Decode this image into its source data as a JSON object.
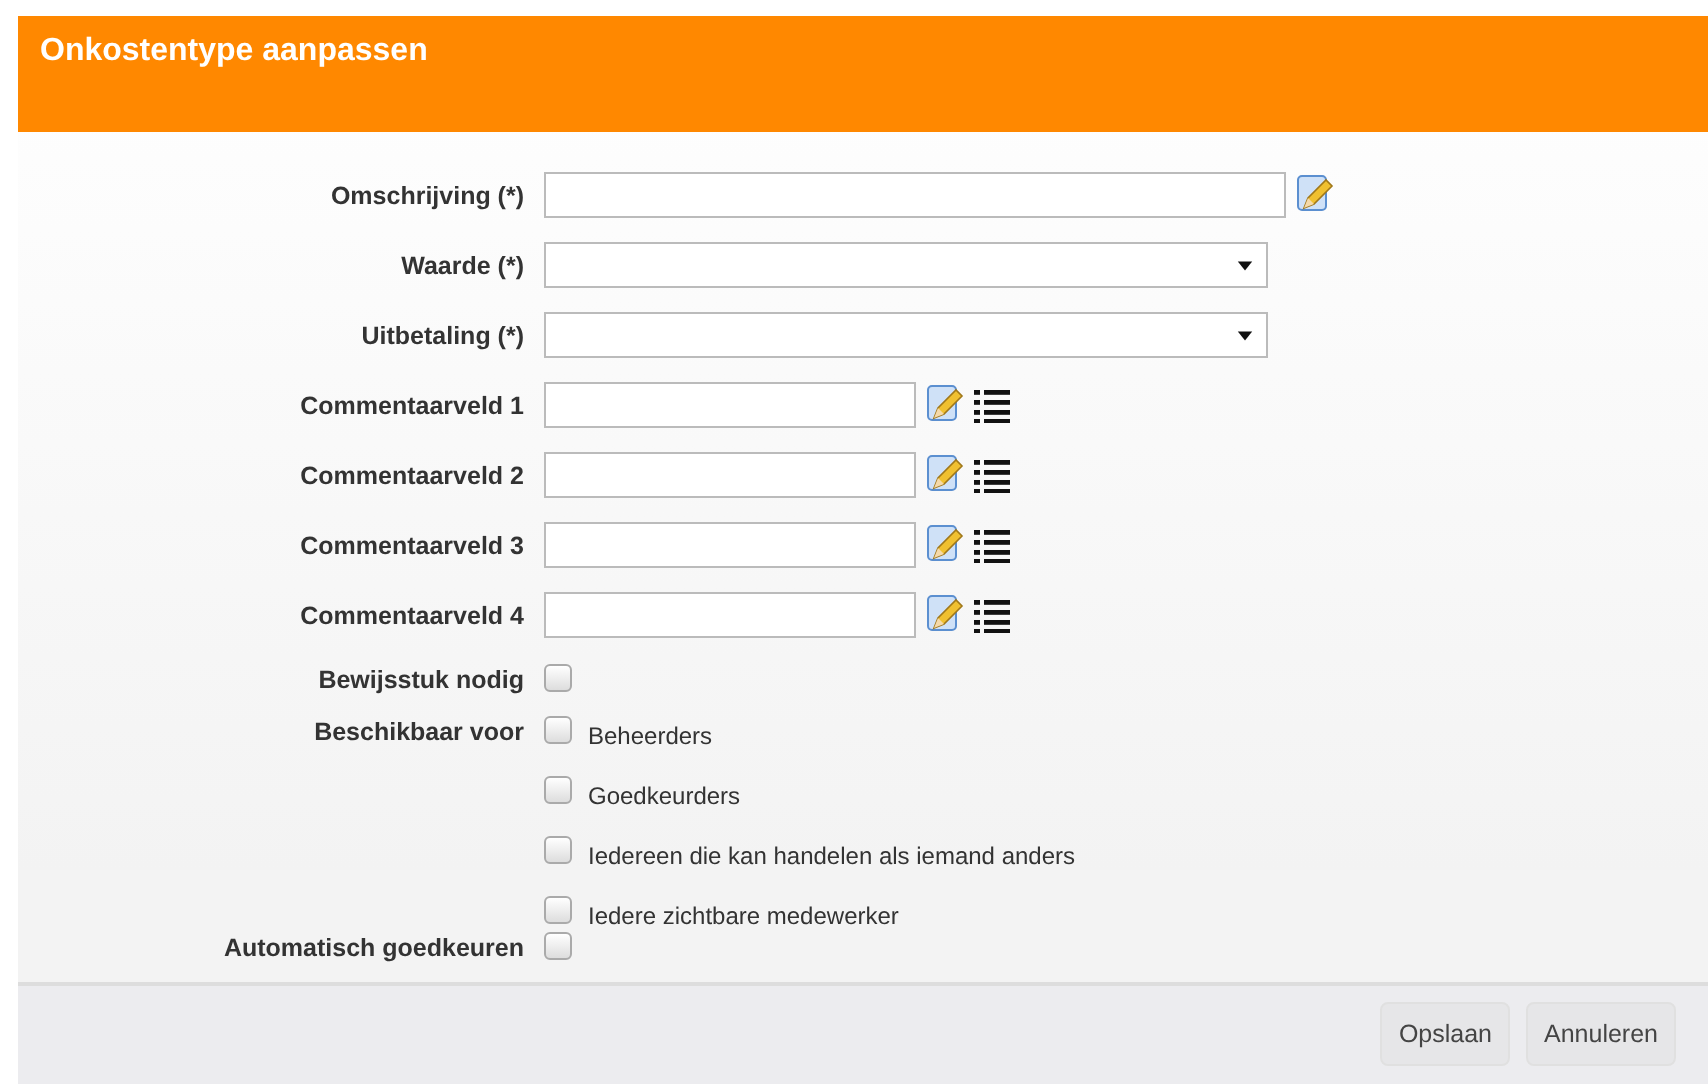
{
  "dialog": {
    "title": "Onkostentype aanpassen"
  },
  "fields": [
    {
      "label": "Omschrijving (*)",
      "kind": "text"
    },
    {
      "label": "Waarde (*)",
      "kind": "select"
    },
    {
      "label": "Uitbetaling (*)",
      "kind": "select"
    },
    {
      "label": "Commentaarveld 1",
      "kind": "comment"
    },
    {
      "label": "Commentaarveld 2",
      "kind": "comment"
    },
    {
      "label": "Commentaarveld 3",
      "kind": "comment"
    },
    {
      "label": "Commentaarveld 4",
      "kind": "comment"
    }
  ],
  "checks": [
    {
      "label": "Bewijsstuk nodig",
      "checked": false
    },
    {
      "label": "Beschikbaar voor",
      "options": [
        {
          "label": "Beheerders",
          "checked": false
        },
        {
          "label": "Goedkeurders",
          "checked": false
        },
        {
          "label": "Iedereen die kan handelen als iemand anders",
          "checked": false
        },
        {
          "label": "Iedere zichtbare medewerker",
          "checked": false
        }
      ]
    },
    {
      "label": "Automatisch goedkeuren",
      "checked": false
    }
  ],
  "buttons": [
    "Opslaan",
    "Annuleren"
  ]
}
